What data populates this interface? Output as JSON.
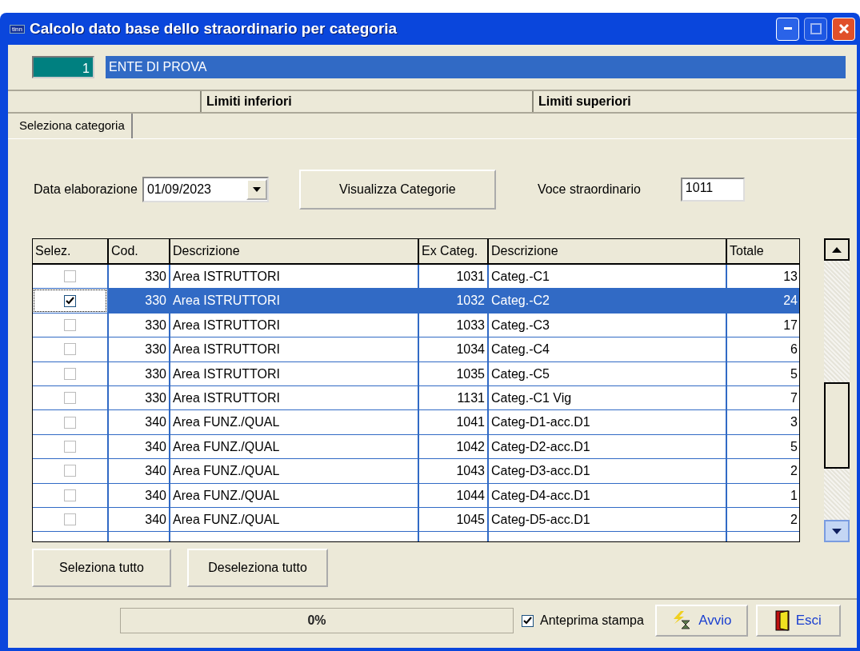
{
  "window": {
    "title": "Calcolo dato base dello straordinario per categoria",
    "app_icon": "tinn"
  },
  "entity": {
    "code": "1",
    "name": "ENTE DI PROVA"
  },
  "band": [
    "Limiti inferiori",
    "Limiti superiori"
  ],
  "tabs": [
    {
      "label": "Seleziona categoria",
      "selected": true
    }
  ],
  "form": {
    "date_label": "Data elaborazione",
    "date": "01/09/2023",
    "show_button": "Visualizza Categorie",
    "voce_label": "Voce straordinario",
    "voce": "1011"
  },
  "table": {
    "columns": [
      "Selez.",
      "Cod.",
      "Descrizione",
      "Ex Categ.",
      "Descrizione",
      "Totale"
    ],
    "rows": [
      {
        "checked": false,
        "selected": false,
        "cod": "330",
        "area": "Area ISTRUTTORI",
        "ex": "1031",
        "categ": "Categ.-C1",
        "totale": "13"
      },
      {
        "checked": true,
        "selected": true,
        "cod": "330",
        "area": "Area ISTRUTTORI",
        "ex": "1032",
        "categ": "Categ.-C2",
        "totale": "24"
      },
      {
        "checked": false,
        "selected": false,
        "cod": "330",
        "area": "Area ISTRUTTORI",
        "ex": "1033",
        "categ": "Categ.-C3",
        "totale": "17"
      },
      {
        "checked": false,
        "selected": false,
        "cod": "330",
        "area": "Area ISTRUTTORI",
        "ex": "1034",
        "categ": "Categ.-C4",
        "totale": "6"
      },
      {
        "checked": false,
        "selected": false,
        "cod": "330",
        "area": "Area ISTRUTTORI",
        "ex": "1035",
        "categ": "Categ.-C5",
        "totale": "5"
      },
      {
        "checked": false,
        "selected": false,
        "cod": "330",
        "area": "Area ISTRUTTORI",
        "ex": "1131",
        "categ": "Categ.-C1 Vig",
        "totale": "7"
      },
      {
        "checked": false,
        "selected": false,
        "cod": "340",
        "area": "Area FUNZ./QUAL",
        "ex": "1041",
        "categ": "Categ-D1-acc.D1",
        "totale": "3"
      },
      {
        "checked": false,
        "selected": false,
        "cod": "340",
        "area": "Area FUNZ./QUAL",
        "ex": "1042",
        "categ": "Categ-D2-acc.D1",
        "totale": "5"
      },
      {
        "checked": false,
        "selected": false,
        "cod": "340",
        "area": "Area FUNZ./QUAL",
        "ex": "1043",
        "categ": "Categ-D3-acc.D1",
        "totale": "2"
      },
      {
        "checked": false,
        "selected": false,
        "cod": "340",
        "area": "Area FUNZ./QUAL",
        "ex": "1044",
        "categ": "Categ-D4-acc.D1",
        "totale": "1"
      },
      {
        "checked": false,
        "selected": false,
        "cod": "340",
        "area": "Area FUNZ./QUAL",
        "ex": "1045",
        "categ": "Categ-D5-acc.D1",
        "totale": "2"
      }
    ]
  },
  "buttons": [
    "Seleziona tutto",
    "Deseleziona tutto"
  ],
  "status": {
    "progress": "0%",
    "preview": {
      "label": "Anteprima stampa",
      "checked": true
    },
    "start": "Avvio",
    "exit": "Esci"
  }
}
